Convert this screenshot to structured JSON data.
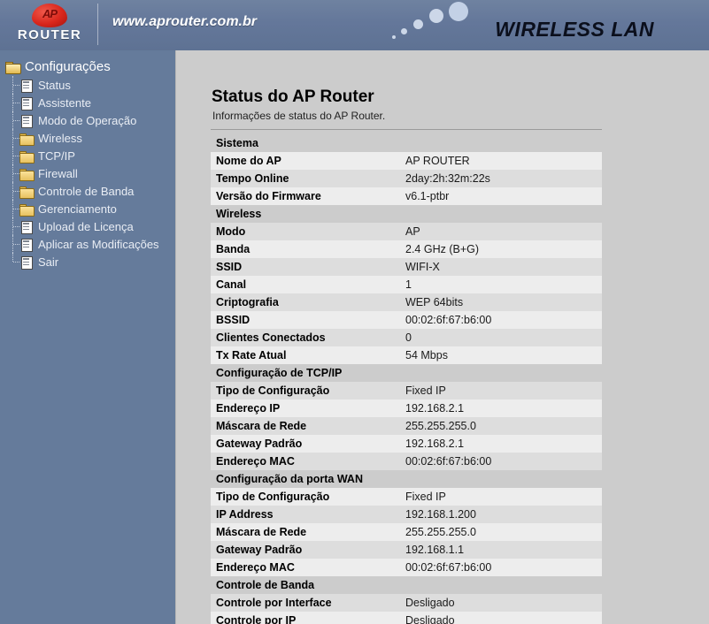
{
  "header": {
    "logo_mark": "ap-logo",
    "logo_word": "ROUTER",
    "site_url": "www.aprouter.com.br",
    "wireless_lan_text": "WIRELESS LAN"
  },
  "sidebar": {
    "root": {
      "label": "Configurações",
      "icon": "folder-open-icon"
    },
    "items": [
      {
        "label": "Status",
        "icon": "page-icon"
      },
      {
        "label": "Assistente",
        "icon": "page-icon"
      },
      {
        "label": "Modo de Operação",
        "icon": "page-icon"
      },
      {
        "label": "Wireless",
        "icon": "folder-icon"
      },
      {
        "label": "TCP/IP",
        "icon": "folder-icon"
      },
      {
        "label": "Firewall",
        "icon": "folder-icon"
      },
      {
        "label": "Controle de Banda",
        "icon": "folder-icon"
      },
      {
        "label": "Gerenciamento",
        "icon": "folder-icon"
      },
      {
        "label": "Upload de Licença",
        "icon": "page-icon"
      },
      {
        "label": "Aplicar as Modificações",
        "icon": "page-icon"
      },
      {
        "label": "Sair",
        "icon": "page-icon"
      }
    ]
  },
  "main": {
    "title": "Status do AP Router",
    "subtitle": "Informações de status do AP Router.",
    "rows": [
      {
        "type": "section",
        "label": "Sistema"
      },
      {
        "type": "data",
        "key": "Nome do AP",
        "value": "AP ROUTER"
      },
      {
        "type": "data",
        "key": "Tempo Online",
        "value": "2day:2h:32m:22s"
      },
      {
        "type": "data",
        "key": "Versão do Firmware",
        "value": "v6.1-ptbr"
      },
      {
        "type": "section",
        "label": "Wireless"
      },
      {
        "type": "data",
        "key": "Modo",
        "value": "AP"
      },
      {
        "type": "data",
        "key": "Banda",
        "value": "2.4 GHz (B+G)"
      },
      {
        "type": "data",
        "key": "SSID",
        "value": "WIFI-X"
      },
      {
        "type": "data",
        "key": "Canal",
        "value": "1"
      },
      {
        "type": "data",
        "key": "Criptografia",
        "value": "WEP 64bits"
      },
      {
        "type": "data",
        "key": "BSSID",
        "value": "00:02:6f:67:b6:00"
      },
      {
        "type": "data",
        "key": "Clientes Conectados",
        "value": "0"
      },
      {
        "type": "data",
        "key": "Tx Rate Atual",
        "value": "54 Mbps"
      },
      {
        "type": "section",
        "label": "Configuração de TCP/IP"
      },
      {
        "type": "data",
        "key": "Tipo de Configuração",
        "value": "Fixed IP"
      },
      {
        "type": "data",
        "key": "Endereço IP",
        "value": "192.168.2.1"
      },
      {
        "type": "data",
        "key": "Máscara de Rede",
        "value": "255.255.255.0"
      },
      {
        "type": "data",
        "key": "Gateway Padrão",
        "value": "192.168.2.1"
      },
      {
        "type": "data",
        "key": "Endereço MAC",
        "value": "00:02:6f:67:b6:00"
      },
      {
        "type": "section",
        "label": "Configuração da porta WAN"
      },
      {
        "type": "data",
        "key": "Tipo de Configuração",
        "value": "Fixed IP"
      },
      {
        "type": "data",
        "key": "IP Address",
        "value": "192.168.1.200"
      },
      {
        "type": "data",
        "key": "Máscara de Rede",
        "value": "255.255.255.0"
      },
      {
        "type": "data",
        "key": "Gateway Padrão",
        "value": "192.168.1.1"
      },
      {
        "type": "data",
        "key": "Endereço MAC",
        "value": "00:02:6f:67:b6:00"
      },
      {
        "type": "section",
        "label": "Controle de Banda"
      },
      {
        "type": "data",
        "key": "Controle por Interface",
        "value": "Desligado"
      },
      {
        "type": "data",
        "key": "Controle por IP",
        "value": "Desligado"
      }
    ]
  },
  "colors": {
    "header_blue": "#64779a",
    "sidebar_blue": "#657b9b",
    "content_gray": "#cccccc",
    "row_light": "#ededed",
    "row_dark": "#dddddd",
    "logo_red": "#d9261c"
  }
}
